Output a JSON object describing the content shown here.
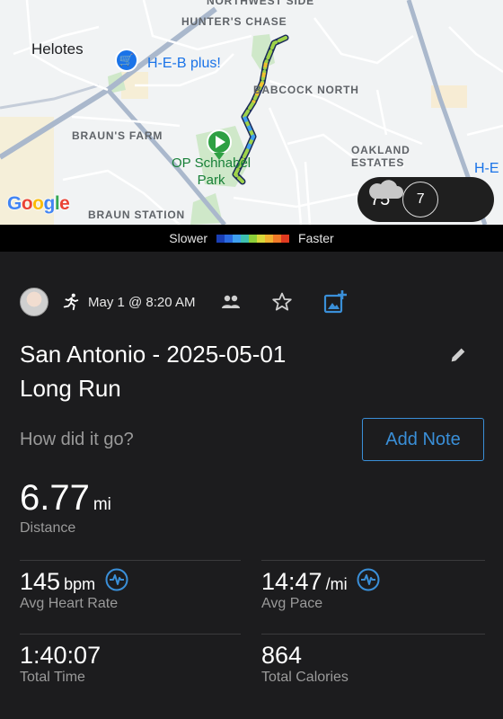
{
  "map": {
    "labels": {
      "northwest_side": "NORTHWEST SIDE",
      "hunters_chase": "HUNTER'S CHASE",
      "helotes": "Helotes",
      "heb": "H-E-B plus!",
      "babcock_north": "BABCOCK NORTH",
      "brauns_farm": "BRAUN'S FARM",
      "park": "OP Schnabel\nPark",
      "oakland_estates": "OAKLAND\nESTATES",
      "heb_right": "H-E",
      "braun_station": "BRAUN STATION"
    },
    "google_logo": [
      "G",
      "o",
      "o",
      "g",
      "l",
      "e"
    ],
    "google_colors": [
      "#4285F4",
      "#EA4335",
      "#FBBC05",
      "#4285F4",
      "#34A853",
      "#EA4335"
    ],
    "weather": {
      "temperature": "75°",
      "uv_index": "7",
      "icon": "cloud-icon"
    }
  },
  "legend": {
    "slower": "Slower",
    "faster": "Faster",
    "colors": [
      "#1a3fb5",
      "#2a6ae0",
      "#3fa0f0",
      "#3dc0b0",
      "#8ccf3a",
      "#d8d83a",
      "#f0b030",
      "#f07a28",
      "#e03a20"
    ]
  },
  "activity": {
    "date": "May 1 @ 8:20 AM",
    "title": "San Antonio - 2025-05-01\nLong Run",
    "prompt": "How did it go?",
    "add_note": "Add Note",
    "distance": {
      "value": "6.77",
      "unit": "mi",
      "label": "Distance"
    },
    "stats": [
      {
        "value": "145",
        "unit": "bpm",
        "label": "Avg Heart Rate"
      },
      {
        "value": "14:47",
        "unit": "/mi",
        "label": "Avg Pace"
      },
      {
        "value": "1:40:07",
        "unit": "",
        "label": "Total Time"
      },
      {
        "value": "864",
        "unit": "",
        "label": "Total Calories"
      }
    ]
  },
  "colors": {
    "accent": "#3a8fd8",
    "background": "#1c1c1e"
  }
}
